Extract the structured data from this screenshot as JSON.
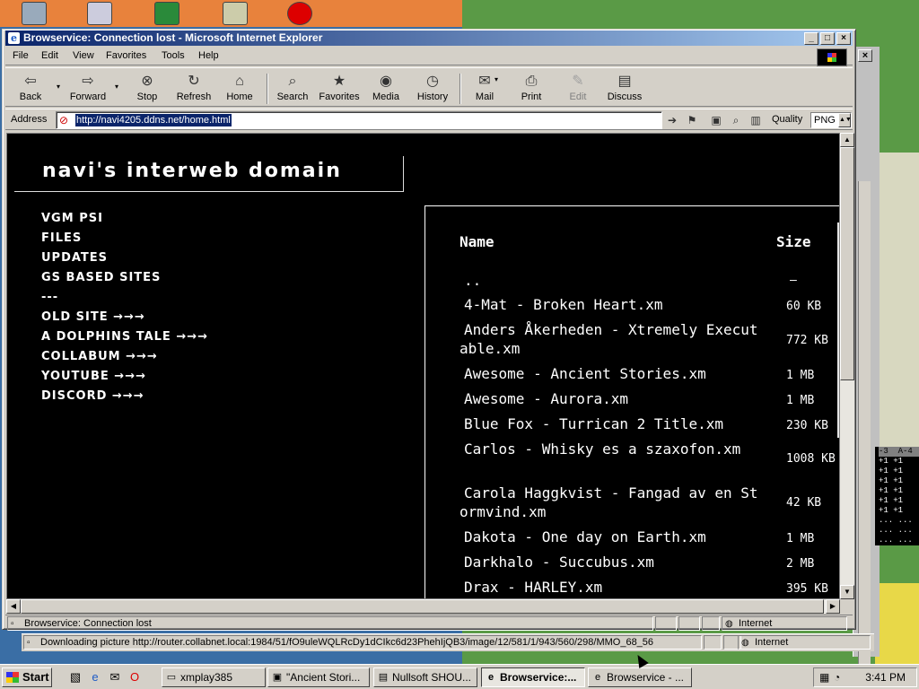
{
  "window": {
    "title": "Browservice: Connection lost - Microsoft Internet Explorer"
  },
  "menu": {
    "file": "File",
    "edit": "Edit",
    "view": "View",
    "favorites": "Favorites",
    "tools": "Tools",
    "help": "Help"
  },
  "toolbar": {
    "back": "Back",
    "forward": "Forward",
    "stop": "Stop",
    "refresh": "Refresh",
    "home": "Home",
    "search": "Search",
    "favorites": "Favorites",
    "media": "Media",
    "history": "History",
    "mail": "Mail",
    "print": "Print",
    "edit": "Edit",
    "discuss": "Discuss"
  },
  "address": {
    "label": "Address",
    "url": "http://navi4205.ddns.net/home.html",
    "quality_label": "Quality",
    "quality_value": "PNG"
  },
  "page": {
    "site_title": "navi's interweb domain",
    "nav": [
      "VGM PSI",
      "FILES",
      "UPDATES",
      "GS BASED SITES",
      "---",
      "OLD SITE →→→",
      "A DOLPHINS TALE →→→",
      "COLLABUM →→→",
      "YOUTUBE →→→",
      "DISCORD →→→"
    ],
    "files": {
      "header_name": "Name",
      "header_size": "Size",
      "rows": [
        {
          "name": "..",
          "size": "–"
        },
        {
          "name": "4-Mat - Broken Heart.xm",
          "size": "60 KB"
        },
        {
          "name": "Anders Åkerheden - Xtremely Executable.xm",
          "size": "772 KB"
        },
        {
          "name": "Awesome - Ancient Stories.xm",
          "size": "1 MB"
        },
        {
          "name": "Awesome - Aurora.xm",
          "size": "1 MB"
        },
        {
          "name": "Blue Fox - Turrican 2 Title.xm",
          "size": "230 KB"
        },
        {
          "name": "Carlos - Whisky es a szaxofon.xm",
          "size": "1008 KB"
        },
        {
          "name": "Carola Haggkvist - Fangad av en Stormvind.xm",
          "size": "42 KB"
        },
        {
          "name": "Dakota - One day on Earth.xm",
          "size": "1 MB"
        },
        {
          "name": "Darkhalo - Succubus.xm",
          "size": "2 MB"
        },
        {
          "name": "Drax - HARLEY.xm",
          "size": "395 KB"
        }
      ]
    }
  },
  "status": {
    "text": "Browservice: Connection lost",
    "zone": "Internet"
  },
  "outer_status": {
    "text": "Downloading picture http://router.collabnet.local:1984/51/fO9uleWQLRcDy1dCIkc6d23PhehIjQB3/image/12/581/1/943/560/298/MMO_68_56",
    "zone": "Internet"
  },
  "tracker": {
    "headers": [
      "-3",
      "A-4"
    ],
    "rows": [
      "+1 +1",
      "+1 +1",
      "+1 +1",
      "+1 +1",
      "+1 +1",
      "+1 +1",
      "... ...",
      "... ...",
      "... ..."
    ]
  },
  "taskbar": {
    "start": "Start",
    "tasks": [
      "xmplay385",
      "\"Ancient Stori...",
      "Nullsoft SHOU...",
      "Browservice:...",
      "Browservice - ..."
    ],
    "clock": "3:41 PM"
  }
}
